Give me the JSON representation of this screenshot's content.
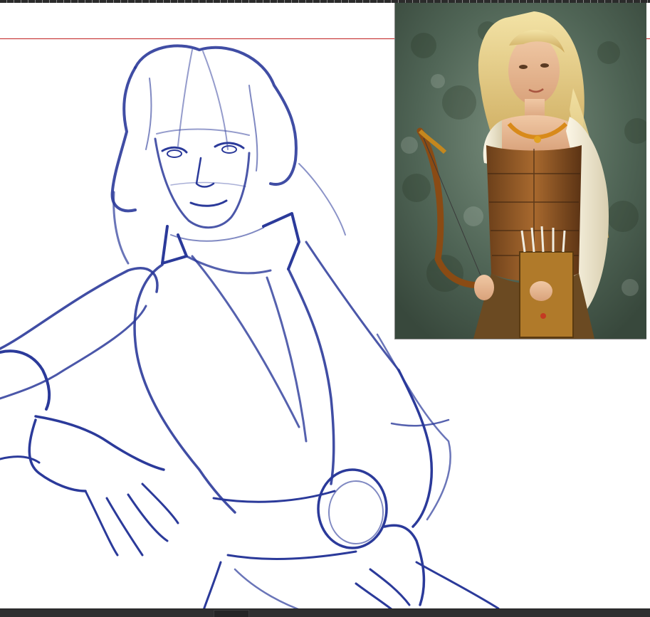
{
  "app": {
    "background_color": "#ffffff",
    "chrome_color": "#2f3031"
  },
  "canvas": {
    "sketch_stroke_color": "#2b3a9a",
    "guide_color": "#c02020"
  },
  "reference": {
    "subject_icon": "archer-portrait"
  },
  "statusbar": {
    "tab_label": ""
  }
}
